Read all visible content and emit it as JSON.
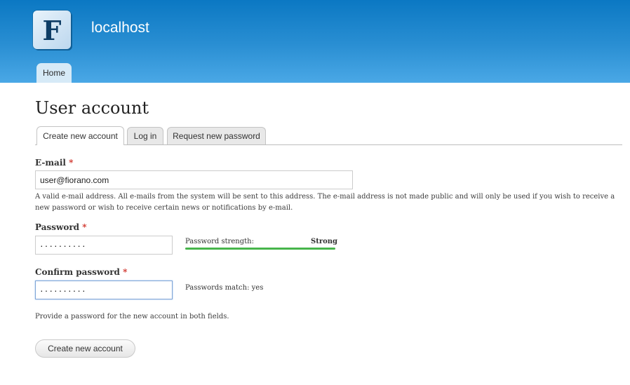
{
  "header": {
    "site_name": "localhost",
    "logo_letter": "F",
    "nav": [
      {
        "label": "Home"
      }
    ],
    "colors": {
      "gradient_top": "#0b78c3",
      "gradient_bottom": "#4aa8e6"
    }
  },
  "page": {
    "title": "User account"
  },
  "tabs": [
    {
      "label": "Create new account",
      "active": true
    },
    {
      "label": "Log in",
      "active": false
    },
    {
      "label": "Request new password",
      "active": false
    }
  ],
  "form": {
    "email": {
      "label": "E-mail",
      "required_mark": "*",
      "value": "user@fiorano.com",
      "description": "A valid e-mail address. All e-mails from the system will be sent to this address. The e-mail address is not made public and will only be used if you wish to receive a new password or wish to receive certain news or notifications by e-mail."
    },
    "password": {
      "label": "Password",
      "required_mark": "*",
      "masked_value": "··········",
      "strength_label": "Password strength:",
      "strength_value": "Strong",
      "strength_level": 1.0,
      "strength_color": "#47b54b"
    },
    "confirm_password": {
      "label": "Confirm password",
      "required_mark": "*",
      "masked_value": "··········",
      "match_text": "Passwords match: yes"
    },
    "hint": "Provide a password for the new account in both fields.",
    "submit_label": "Create new account"
  }
}
